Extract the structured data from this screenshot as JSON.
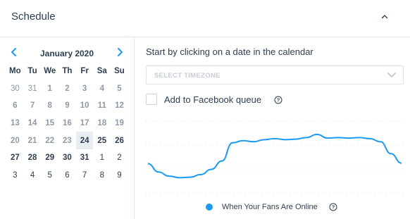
{
  "header": {
    "title": "Schedule"
  },
  "calendar": {
    "month": "January 2020",
    "weekdays": [
      "Mo",
      "Tu",
      "We",
      "Th",
      "Fr",
      "Sa",
      "Su"
    ],
    "selected_day": "24",
    "days": [
      {
        "d": "30",
        "t": "prev"
      },
      {
        "d": "31",
        "t": "prev"
      },
      {
        "d": "1",
        "t": "past"
      },
      {
        "d": "2",
        "t": "past"
      },
      {
        "d": "3",
        "t": "past"
      },
      {
        "d": "4",
        "t": "past"
      },
      {
        "d": "5",
        "t": "past"
      },
      {
        "d": "6",
        "t": "past"
      },
      {
        "d": "7",
        "t": "past"
      },
      {
        "d": "8",
        "t": "past"
      },
      {
        "d": "9",
        "t": "past"
      },
      {
        "d": "10",
        "t": "past"
      },
      {
        "d": "11",
        "t": "past"
      },
      {
        "d": "12",
        "t": "past"
      },
      {
        "d": "13",
        "t": "past"
      },
      {
        "d": "14",
        "t": "past"
      },
      {
        "d": "15",
        "t": "past"
      },
      {
        "d": "16",
        "t": "past"
      },
      {
        "d": "17",
        "t": "past"
      },
      {
        "d": "18",
        "t": "past"
      },
      {
        "d": "19",
        "t": "past"
      },
      {
        "d": "20",
        "t": "past"
      },
      {
        "d": "21",
        "t": "past"
      },
      {
        "d": "22",
        "t": "past"
      },
      {
        "d": "23",
        "t": "past"
      },
      {
        "d": "24",
        "t": "cur"
      },
      {
        "d": "25",
        "t": "cur"
      },
      {
        "d": "26",
        "t": "cur"
      },
      {
        "d": "27",
        "t": "cur"
      },
      {
        "d": "28",
        "t": "cur"
      },
      {
        "d": "29",
        "t": "cur"
      },
      {
        "d": "30",
        "t": "cur"
      },
      {
        "d": "31",
        "t": "cur"
      },
      {
        "d": "1",
        "t": "next"
      },
      {
        "d": "2",
        "t": "next"
      },
      {
        "d": "3",
        "t": "next"
      },
      {
        "d": "4",
        "t": "next"
      },
      {
        "d": "5",
        "t": "next"
      },
      {
        "d": "6",
        "t": "next"
      },
      {
        "d": "7",
        "t": "next"
      },
      {
        "d": "8",
        "t": "next"
      },
      {
        "d": "9",
        "t": "next"
      }
    ]
  },
  "instruction": "Start by clicking on a date in the calendar",
  "timezone": {
    "placeholder": "SELECT TIMEZONE"
  },
  "facebook_queue": {
    "label": "Add to Facebook queue",
    "checked": false
  },
  "chart_data": {
    "type": "line",
    "series": [
      {
        "name": "When Your Fans Are Online",
        "values": [
          0.36,
          0.2,
          0.12,
          0.09,
          0.1,
          0.15,
          0.25,
          0.41,
          0.76,
          0.8,
          0.78,
          0.82,
          0.84,
          0.82,
          0.83,
          0.86,
          0.92,
          0.85,
          0.86,
          0.85,
          0.86,
          0.84,
          0.78,
          0.55,
          0.37
        ]
      }
    ],
    "grid": true,
    "colors": {
      "line": "#1a9bf0",
      "grid": "#dfe3e8"
    }
  },
  "legend": {
    "label": "When Your Fans Are Online"
  },
  "colors": {
    "text": "#2d3e50",
    "accent": "#1a9bf0",
    "border": "#e3e6ea"
  }
}
